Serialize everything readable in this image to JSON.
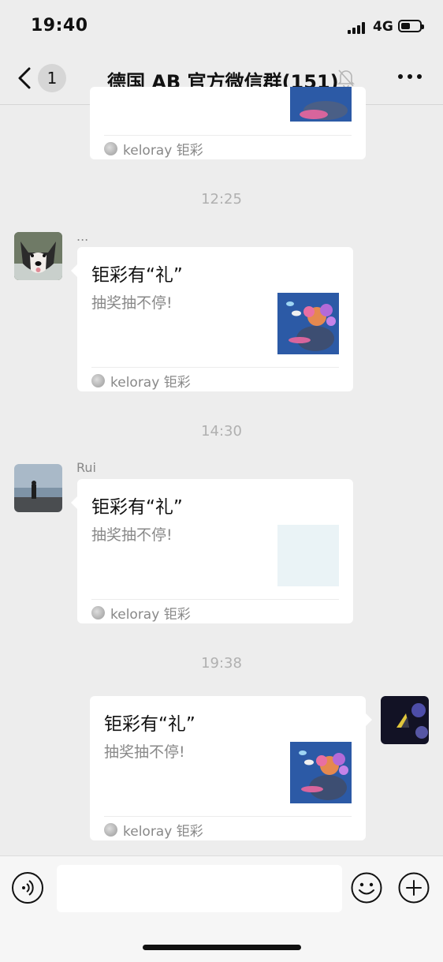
{
  "status_bar": {
    "time": "19:40",
    "network": "4G",
    "battery_level": 0.5
  },
  "nav": {
    "back_count": "1",
    "title": "德国 AB  官方微信群(151)"
  },
  "messages": [
    {
      "timestamp": "",
      "sender": "",
      "title": "",
      "description": "",
      "source": "keloray 钜彩"
    },
    {
      "timestamp": "12:25",
      "sender": "...",
      "title": "钜彩有“礼”",
      "description": "抽奖抽不停!",
      "source": "keloray 钜彩"
    },
    {
      "timestamp": "14:30",
      "sender": "Rui",
      "title": "钜彩有“礼”",
      "description": "抽奖抽不停!",
      "source": "keloray 钜彩"
    },
    {
      "timestamp": "19:38",
      "sender": "",
      "title": "钜彩有“礼”",
      "description": "抽奖抽不停!",
      "source": "keloray 钜彩"
    }
  ],
  "input": {
    "placeholder": ""
  },
  "icons": {
    "back": "chevron-left-icon",
    "mute": "bell-off-icon",
    "more": "more-dots-icon",
    "voice": "voice-icon",
    "emoji": "emoji-icon",
    "plus": "plus-icon"
  }
}
